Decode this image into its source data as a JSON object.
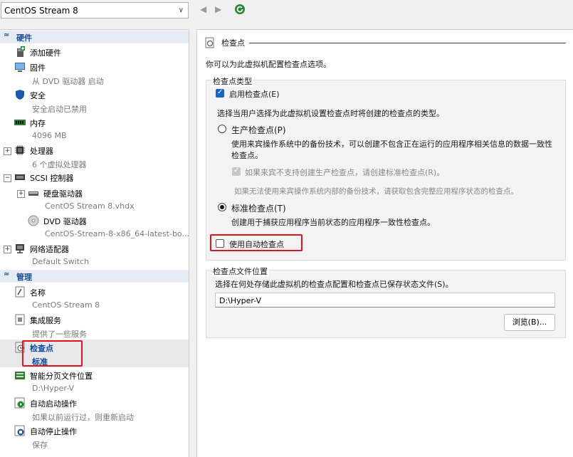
{
  "toolbar": {
    "vm_selected": "CentOS Stream 8",
    "back": "◀",
    "forward": "▶"
  },
  "sidebar": {
    "hardware_title": "硬件",
    "management_title": "管理",
    "hardware": [
      {
        "label": "添加硬件",
        "sub": ""
      },
      {
        "label": "固件",
        "sub": "从 DVD 驱动器 启动"
      },
      {
        "label": "安全",
        "sub": "安全启动已禁用"
      },
      {
        "label": "内存",
        "sub": "4096 MB"
      },
      {
        "label": "处理器",
        "sub": "6 个虚拟处理器"
      },
      {
        "label": "SCSI 控制器",
        "sub": ""
      },
      {
        "label": "硬盘驱动器",
        "sub": "CentOS Stream 8.vhdx"
      },
      {
        "label": "DVD 驱动器",
        "sub": "CentOS-Stream-8-x86_64-latest-bo..."
      },
      {
        "label": "网络适配器",
        "sub": "Default Switch"
      }
    ],
    "management": [
      {
        "label": "名称",
        "sub": "CentOS Stream 8"
      },
      {
        "label": "集成服务",
        "sub": "提供了一些服务"
      },
      {
        "label": "检查点",
        "sub": "标准"
      },
      {
        "label": "智能分页文件位置",
        "sub": "D:\\Hyper-V"
      },
      {
        "label": "自动启动操作",
        "sub": "如果以前运行过，则重新启动"
      },
      {
        "label": "自动停止操作",
        "sub": "保存"
      }
    ]
  },
  "main": {
    "title": "检查点",
    "description": "你可以为此虚拟机配置检查点选项。",
    "type_group_title": "检查点类型",
    "enable_label": "启用检查点(E)",
    "select_desc": "选择当用户选择为此虚拟机设置检查点时将创建的检查点的类型。",
    "production_label": "生产检查点(P)",
    "production_desc_1": "使用来宾操作系统中的备份技术，可以创建不包含正在运行的应用程序相关信息的数据一致性",
    "production_desc_2": "检查点。",
    "fallback_label": "如果来宾不支持创建生产检查点，请创建标准检查点(R)。",
    "fallback_note": "如果无法使用来宾操作系统内部的备份技术，请获取包含完整应用程序状态的检查点。",
    "standard_label": "标准检查点(T)",
    "standard_desc": "创建用于捕获应用程序当前状态的应用程序一致性检查点。",
    "auto_label": "使用自动检查点",
    "location_group_title": "检查点文件位置",
    "location_desc": "选择在何处存储此虚拟机的检查点配置和检查点已保存状态文件(S)。",
    "location_value": "D:\\Hyper-V",
    "browse_label": "浏览(B)..."
  },
  "colors": {
    "highlight": "#e0141e",
    "accent": "#1964c8"
  }
}
